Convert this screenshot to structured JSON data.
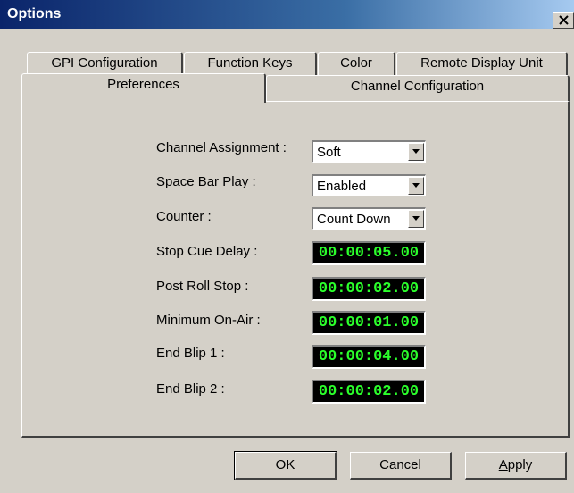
{
  "window": {
    "title": "Options"
  },
  "tabs_back": [
    {
      "label": "GPI Configuration"
    },
    {
      "label": "Function Keys"
    },
    {
      "label": "Color"
    },
    {
      "label": "Remote Display Unit"
    }
  ],
  "tabs_front": [
    {
      "label": "Preferences",
      "active": true
    },
    {
      "label": "Channel Configuration",
      "active": false
    }
  ],
  "fields": {
    "channel_assignment": {
      "label": "Channel Assignment :",
      "value": "Soft"
    },
    "space_bar_play": {
      "label": "Space Bar Play :",
      "value": "Enabled"
    },
    "counter": {
      "label": "Counter :",
      "value": "Count Down"
    },
    "stop_cue_delay": {
      "label": "Stop Cue Delay :",
      "value": "00:00:05.00"
    },
    "post_roll_stop": {
      "label": "Post Roll Stop :",
      "value": "00:00:02.00"
    },
    "minimum_on_air": {
      "label": "Minimum On-Air :",
      "value": "00:00:01.00"
    },
    "end_blip_1": {
      "label": "End Blip 1 :",
      "value": "00:00:04.00"
    },
    "end_blip_2": {
      "label": "End Blip 2 :",
      "value": "00:00:02.00"
    }
  },
  "buttons": {
    "ok": "OK",
    "cancel": "Cancel",
    "apply_first": "A",
    "apply_rest": "pply"
  },
  "colors": {
    "timecode_text": "#2bff2b",
    "timecode_bg": "#000000",
    "title_bar": "#0a246a",
    "dialog_bg": "#d4d0c8"
  },
  "icons": {
    "close": "close-icon",
    "dropdown": "chevron-down-icon"
  }
}
